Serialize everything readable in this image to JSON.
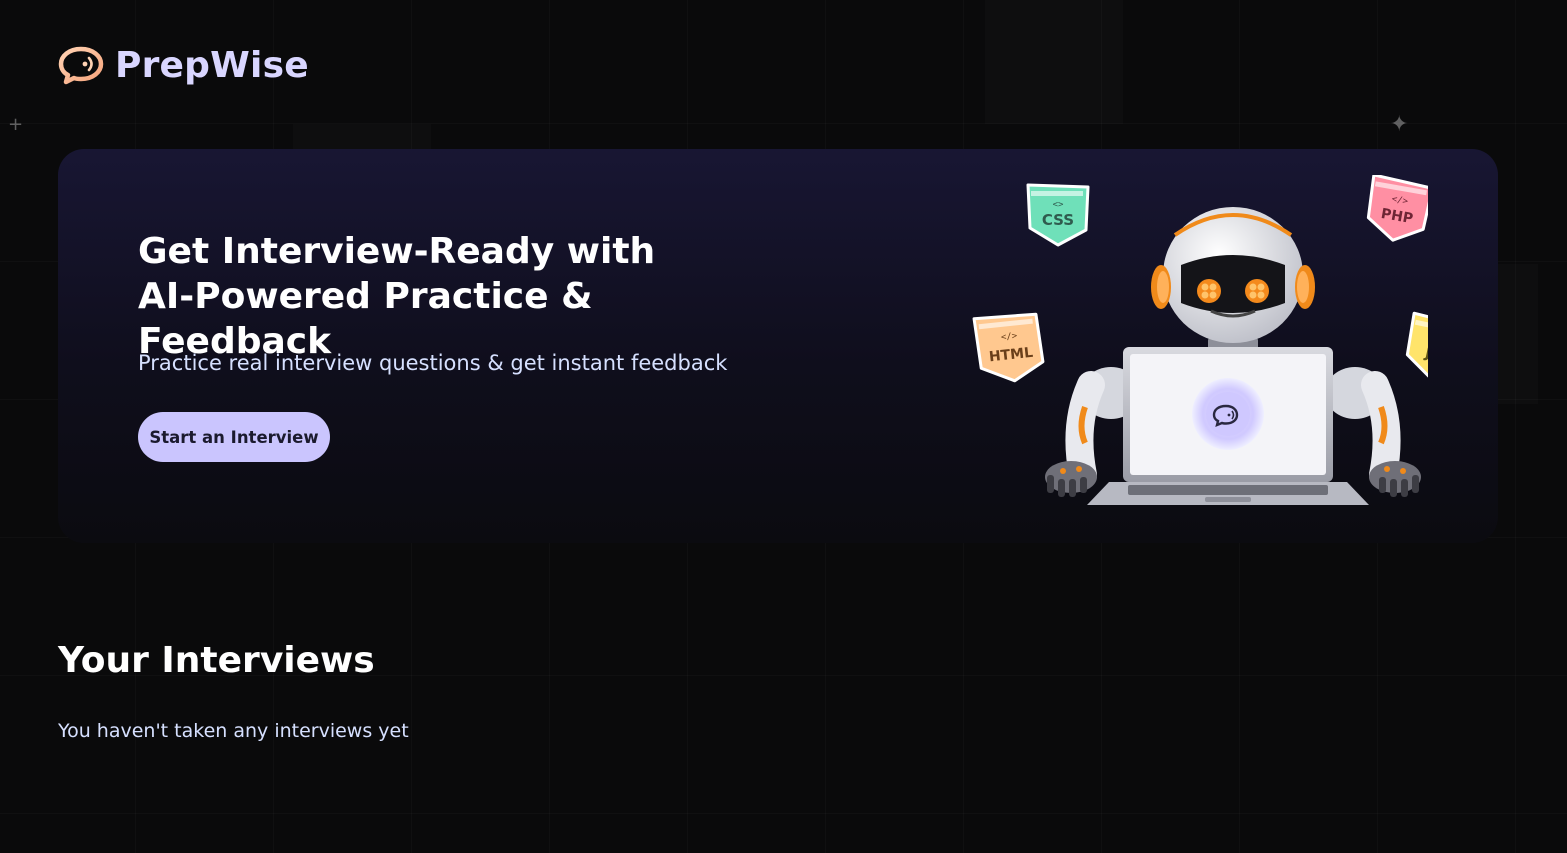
{
  "navbar": {
    "brand": "PrepWise",
    "logo_icon": "chat-bubble-icon"
  },
  "hero": {
    "title": "Get Interview-Ready with AI-Powered Practice & Feedback",
    "subtitle": "Practice real interview questions & get instant feedback",
    "cta_label": "Start an Interview",
    "illustration": {
      "badges": [
        "CSS",
        "PHP",
        "HTML",
        "JS"
      ]
    }
  },
  "interviews": {
    "title": "Your Interviews",
    "empty_text": "You haven't taken any interviews yet"
  },
  "colors": {
    "background": "#0a0a0b",
    "brand_text": "#d9d6ff",
    "accent_button": "#cac5fe",
    "hero_gradient_top": "#181633",
    "muted_text": "#d6e0ff"
  }
}
